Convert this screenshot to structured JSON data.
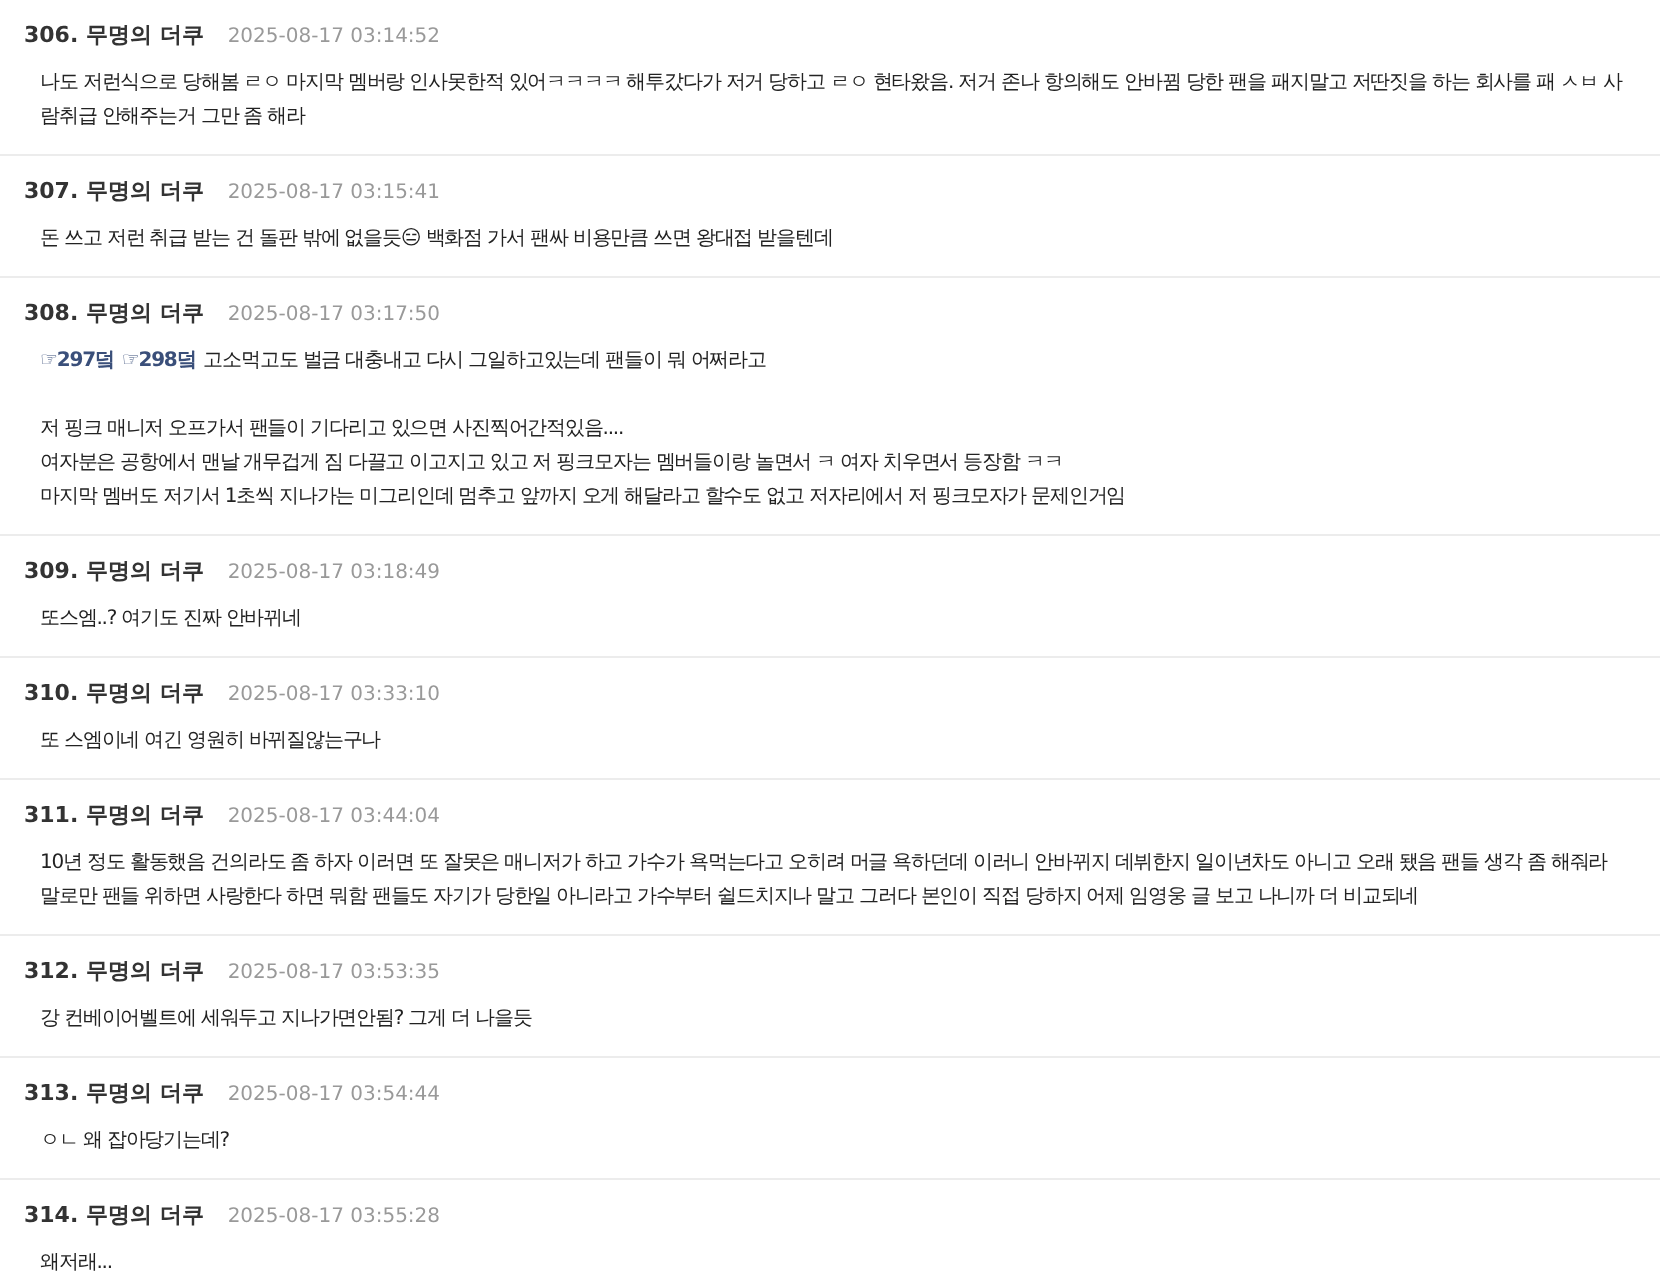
{
  "posts": [
    {
      "number": "306.",
      "author": "무명의 더쿠",
      "date": "2025-08-17 03:14:52",
      "paragraphs": [
        [
          [
            {
              "kind": "text",
              "text": "나도 저런식으로 당해봄 ㄹㅇ 마지막 멤버랑 인사못한적 있어ㅋㅋㅋㅋ 해투갔다가 저거 당하고 ㄹㅇ 현타왔음. 저거 존나 항의해도 안바뀜 당한 팬을 패지말고 저딴짓을 하는 회사를 패 ㅅㅂ 사람취급 안해주는거 그만 좀 해라"
            }
          ]
        ]
      ]
    },
    {
      "number": "307.",
      "author": "무명의 더쿠",
      "date": "2025-08-17 03:15:41",
      "paragraphs": [
        [
          [
            {
              "kind": "text",
              "text": "돈 쓰고 저런 취급 받는 건 돌판 밖에 없을듯😑 백화점 가서 팬싸 비용만큼 쓰면 왕대접 받을텐데"
            }
          ]
        ]
      ]
    },
    {
      "number": "308.",
      "author": "무명의 더쿠",
      "date": "2025-08-17 03:17:50",
      "paragraphs": [
        [
          [
            {
              "kind": "link",
              "text": "☞297덬"
            },
            {
              "kind": "link",
              "text": "☞298덬"
            },
            {
              "kind": "text",
              "text": "고소먹고도 벌금 대충내고 다시 그일하고있는데 팬들이 뭐 어쩌라고"
            }
          ]
        ],
        [
          [
            {
              "kind": "text",
              "text": "저 핑크 매니저 오프가서 팬들이 기다리고 있으면 사진찍어간적있음...."
            }
          ],
          [
            {
              "kind": "text",
              "text": "여자분은 공항에서 맨날 개무겁게 짐 다끌고 이고지고 있고 저 핑크모자는 멤버들이랑 놀면서 ㅋ 여자 치우면서 등장함 ㅋㅋ"
            }
          ],
          [
            {
              "kind": "text",
              "text": "마지막 멤버도 저기서 1초씩 지나가는 미그리인데 멈추고 앞까지 오게 해달라고 할수도 없고 저자리에서 저 핑크모자가 문제인거임"
            }
          ]
        ]
      ]
    },
    {
      "number": "309.",
      "author": "무명의 더쿠",
      "date": "2025-08-17 03:18:49",
      "paragraphs": [
        [
          [
            {
              "kind": "text",
              "text": "또스엠..? 여기도 진짜 안바뀌네"
            }
          ]
        ]
      ]
    },
    {
      "number": "310.",
      "author": "무명의 더쿠",
      "date": "2025-08-17 03:33:10",
      "paragraphs": [
        [
          [
            {
              "kind": "text",
              "text": "또 스엠이네 여긴 영원히 바뀌질않는구나"
            }
          ]
        ]
      ]
    },
    {
      "number": "311.",
      "author": "무명의 더쿠",
      "date": "2025-08-17 03:44:04",
      "paragraphs": [
        [
          [
            {
              "kind": "text",
              "text": "10년 정도 활동했음 건의라도 좀 하자 이러면 또 잘못은 매니저가 하고 가수가 욕먹는다고 오히려 머글 욕하던데 이러니 안바뀌지 데뷔한지 일이년차도 아니고 오래 됐음 팬들 생각 좀 해줘라"
            }
          ],
          [
            {
              "kind": "text",
              "text": "말로만 팬들 위하면 사랑한다 하면 뭐함 팬들도 자기가 당한일 아니라고 가수부터 쉴드치지나 말고 그러다 본인이 직접 당하지 어제 임영웅 글 보고 나니까 더 비교되네"
            }
          ]
        ]
      ]
    },
    {
      "number": "312.",
      "author": "무명의 더쿠",
      "date": "2025-08-17 03:53:35",
      "paragraphs": [
        [
          [
            {
              "kind": "text",
              "text": "강 컨베이어벨트에 세워두고 지나가면안됨? 그게 더 나을듯"
            }
          ]
        ]
      ]
    },
    {
      "number": "313.",
      "author": "무명의 더쿠",
      "date": "2025-08-17 03:54:44",
      "paragraphs": [
        [
          [
            {
              "kind": "text",
              "text": "ㅇㄴ 왜 잡아당기는데?"
            }
          ]
        ]
      ]
    },
    {
      "number": "314.",
      "author": "무명의 더쿠",
      "date": "2025-08-17 03:55:28",
      "paragraphs": [
        [
          [
            {
              "kind": "text",
              "text": "왜저래..."
            }
          ]
        ]
      ]
    }
  ]
}
